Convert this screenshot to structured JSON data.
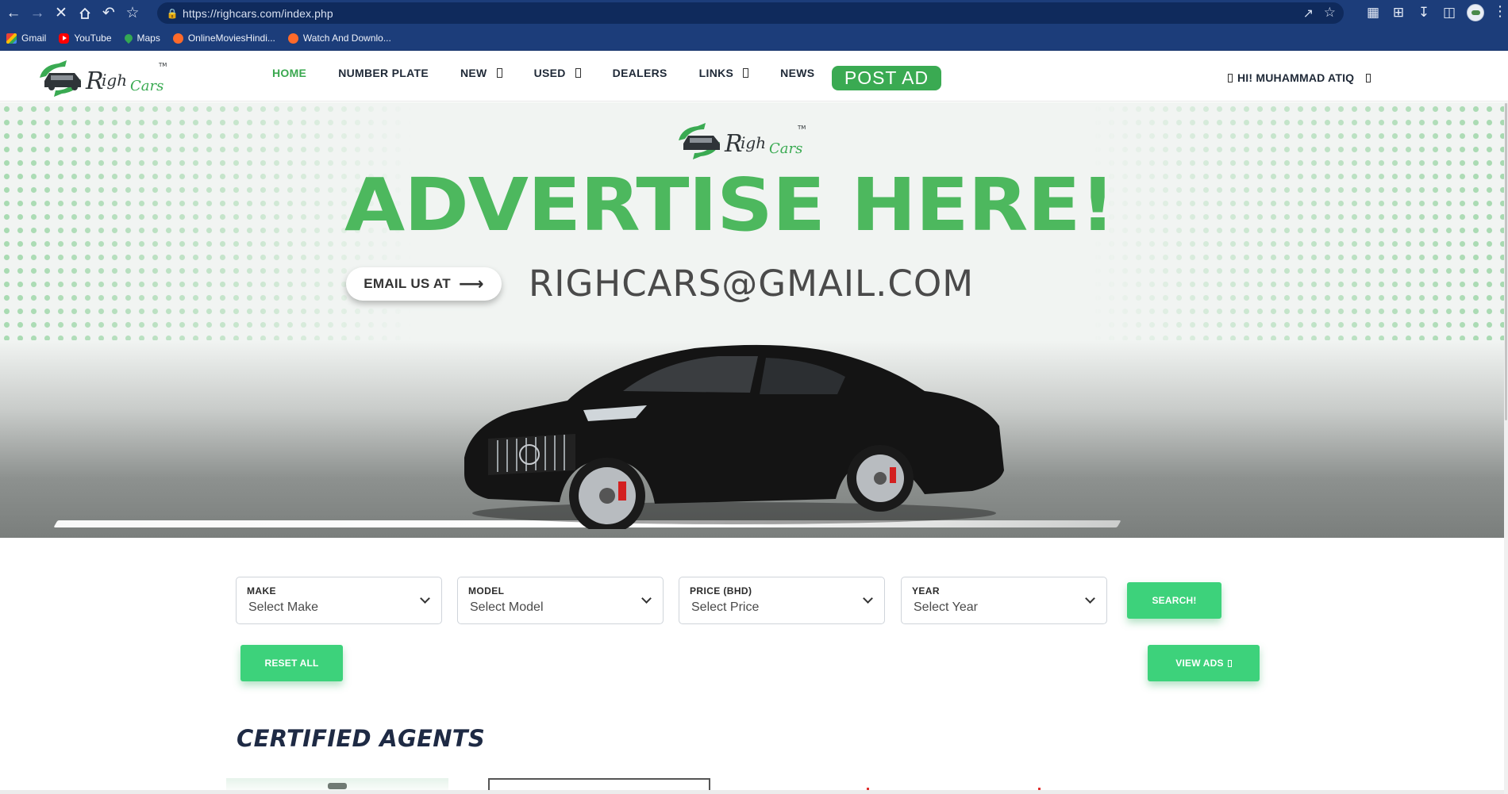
{
  "browser": {
    "url": "https://righcars.com/index.php",
    "bookmarks": [
      {
        "label": "Gmail"
      },
      {
        "label": "YouTube"
      },
      {
        "label": "Maps"
      },
      {
        "label": "OnlineMoviesHindi..."
      },
      {
        "label": "Watch And Downlo..."
      }
    ],
    "toolbar_icons": [
      "back-arrow",
      "forward-arrow",
      "stop-loading-x",
      "home",
      "undo",
      "star-outline"
    ]
  },
  "header": {
    "nav": [
      {
        "label": "HOME",
        "active": true
      },
      {
        "label": "NUMBER PLATE"
      },
      {
        "label": "NEW"
      },
      {
        "label": "USED"
      },
      {
        "label": "DEALERS"
      },
      {
        "label": "LINKS"
      },
      {
        "label": "NEWS"
      }
    ],
    "post_ad_label": "POST AD",
    "user_greeting": "HI! MUHAMMAD ATIQ"
  },
  "hero": {
    "headline": "ADVERTISE HERE!",
    "email_pill": "EMAIL US AT",
    "email": "RIGHCARS@GMAIL.COM"
  },
  "filters": {
    "make": {
      "label": "MAKE",
      "value": "Select Make"
    },
    "model": {
      "label": "MODEL",
      "value": "Select Model"
    },
    "price": {
      "label": "PRICE (BHD)",
      "value": "Select Price"
    },
    "year": {
      "label": "YEAR",
      "value": "Select Year"
    },
    "search_label": "SEARCH!",
    "reset_label": "RESET ALL",
    "view_ads_label": "VIEW ADS"
  },
  "agents": {
    "heading": "CERTIFIED AGENTS"
  },
  "colors": {
    "brand_green": "#3aaa52",
    "button_green": "#3dd27b",
    "headline_green": "#4db85e",
    "chrome_blue": "#1c3d7a"
  }
}
